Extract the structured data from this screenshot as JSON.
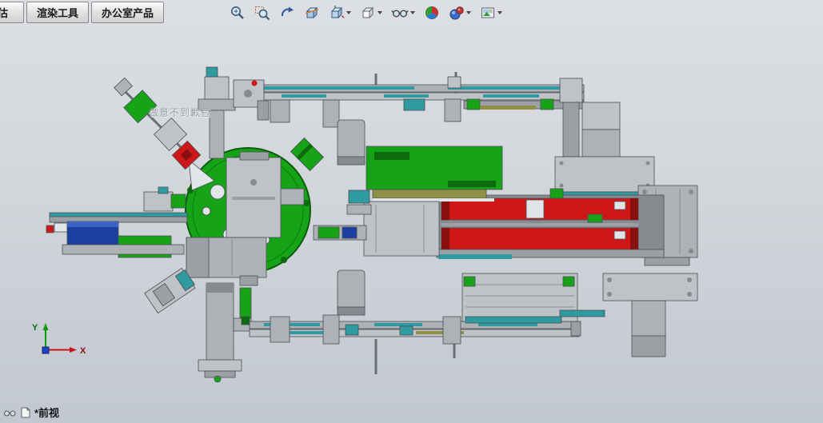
{
  "tabs": {
    "partial": "估",
    "items": [
      {
        "label": "渲染工具"
      },
      {
        "label": "办公室产品"
      }
    ]
  },
  "toolbar": {
    "icons": [
      "zoom-to-fit",
      "zoom-to-area",
      "previous-view",
      "section-view",
      "view-orientation",
      "display-style",
      "hide-show-items",
      "edit-appearance",
      "apply-scene",
      "view-settings"
    ]
  },
  "viewport": {
    "watermark": "做意不到歉苞",
    "view_label": "*前视",
    "axis": {
      "x": "X",
      "y": "Y"
    }
  },
  "colors": {
    "bg-top": "#dcdfe3",
    "bg-mid": "#d2d6db",
    "bg-bottom": "#c2c8d1",
    "part-green": "#17a317",
    "part-green-dark": "#0c6b0c",
    "part-red": "#cf1717",
    "part-red-dark": "#8a0f0f",
    "part-teal": "#2f9aa0",
    "part-blue": "#1b3f9e",
    "part-olive": "#8f8f45",
    "edge": "#4a4f54",
    "axis-x": "#cc1111",
    "axis-y": "#0a9a0a",
    "axis-origin": "#2244cc",
    "watermark": "#9aa0a8"
  }
}
